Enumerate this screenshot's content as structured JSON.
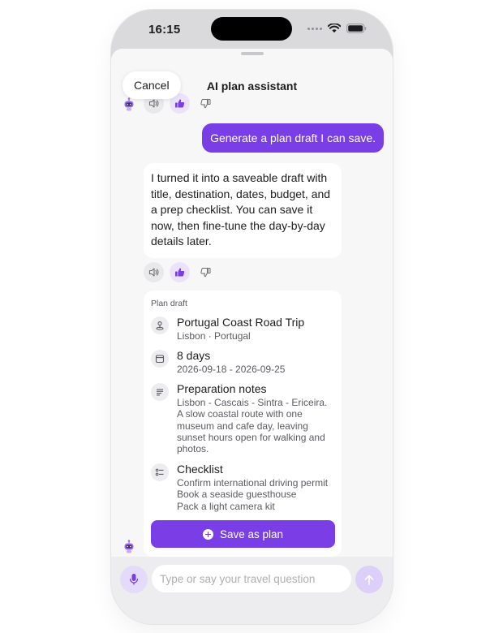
{
  "status_bar": {
    "time": "16:15"
  },
  "header": {
    "title": "AI plan assistant",
    "cancel_label": "Cancel"
  },
  "messages": {
    "user_text": "Generate a plan draft I can save.",
    "assistant_text": "I turned it into a saveable draft with title, destination, dates, budget, and a prep checklist. You can save it now, then fine-tune the day-by-day details later."
  },
  "draft": {
    "label": "Plan draft",
    "title": {
      "icon": "map-pin-icon",
      "primary": "Portugal Coast Road Trip",
      "secondary": "Lisbon · Portugal"
    },
    "dates": {
      "icon": "calendar-icon",
      "primary": "8 days",
      "secondary": "2026-09-18 - 2026-09-25"
    },
    "notes": {
      "icon": "notes-icon",
      "primary": "Preparation notes",
      "secondary": "Lisbon - Cascais - Sintra - Ericeira.\nA slow coastal route with one museum and cafe day, leaving sunset hours open for walking and photos."
    },
    "checklist": {
      "icon": "checklist-icon",
      "primary": "Checklist",
      "secondary": "Confirm international driving permit\nBook a seaside guesthouse\nPack a light camera kit"
    },
    "save_label": "Save as plan"
  },
  "composer": {
    "placeholder": "Type or say your travel question"
  },
  "colors": {
    "accent": "#7a3ee6",
    "sheet_bg": "#f7f7f8",
    "card_bg": "#ffffff"
  }
}
